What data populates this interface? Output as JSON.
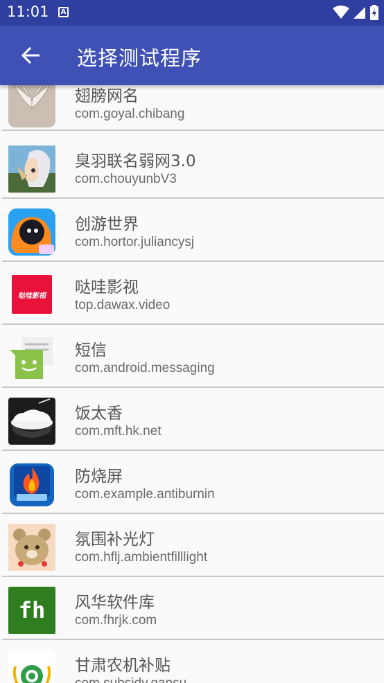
{
  "status_bar": {
    "time": "11:01",
    "notification_icon": "a-letter-notification-icon",
    "icons": [
      "wifi-icon",
      "signal-icon",
      "battery-charging-icon"
    ]
  },
  "app_bar": {
    "back_icon": "arrow-left-icon",
    "title": "选择测试程序"
  },
  "apps": [
    {
      "name": "翅膀网名",
      "package": "com.goyal.chibang",
      "icon": "wings-icon"
    },
    {
      "name": "臭羽联名弱网3.0",
      "package": "com.chouyunbV3",
      "icon": "anime-avatar-icon"
    },
    {
      "name": "创游世界",
      "package": "com.hortor.juliancysj",
      "icon": "game-character-icon"
    },
    {
      "name": "哒哇影视",
      "package": "top.dawax.video",
      "icon": "video-logo-icon"
    },
    {
      "name": "短信",
      "package": "com.android.messaging",
      "icon": "messaging-icon"
    },
    {
      "name": "饭太香",
      "package": "com.mft.hk.net",
      "icon": "rice-bowl-icon"
    },
    {
      "name": "防烧屏",
      "package": "com.example.antiburnin",
      "icon": "flame-screen-icon"
    },
    {
      "name": "氛围补光灯",
      "package": "com.hflj.ambientfilllight",
      "icon": "bear-icon"
    },
    {
      "name": "风华软件库",
      "package": "com.fhrjk.com",
      "icon": "fh-logo-icon"
    },
    {
      "name": "甘肃农机补贴",
      "package": "com.subsidy.gansu",
      "icon": "tractor-badge-icon"
    }
  ],
  "icon_text": {
    "video_logo": "哒哇影视",
    "fh_logo": "fh"
  }
}
